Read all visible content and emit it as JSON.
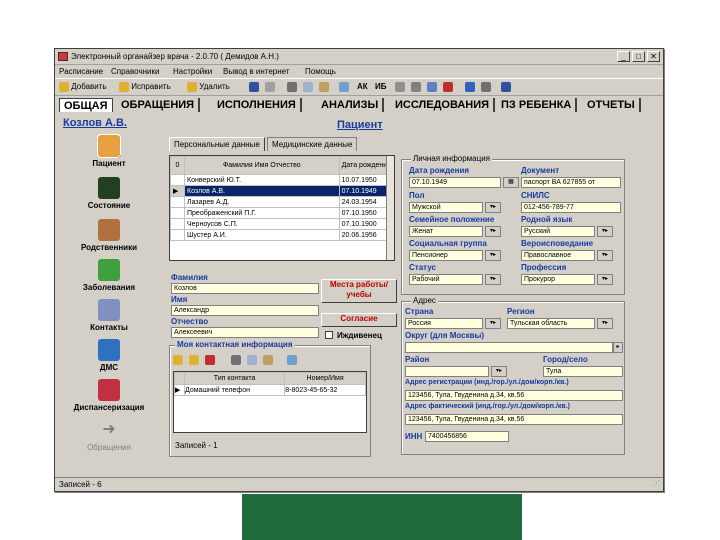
{
  "window": {
    "title": "Электронный органайзер врача - 2.0.70 ( Демидов А.Н.)",
    "min_label": "_",
    "max_label": "□",
    "close_label": "✕"
  },
  "menu": [
    "Расписание",
    "Справочники",
    "Настройки",
    "Вывод в интернет",
    "Помощь"
  ],
  "toolbar": {
    "add_label": "Добавить",
    "edit_label": "Исправить",
    "delete_label": "Удалить",
    "ak_label": "АК",
    "ib_label": "ИБ"
  },
  "main_tabs": [
    "ОБЩАЯ",
    "ОБРАЩЕНИЯ",
    "ИСПОЛНЕНИЯ",
    "АНАЛИЗЫ",
    "ИССЛЕДОВАНИЯ",
    "ПЗ РЕБЕНКА",
    "ОТЧЕТЫ"
  ],
  "patient_name": "Козлов А.В.",
  "patient_link": "Пациент",
  "nav": [
    {
      "label": "Пациент"
    },
    {
      "label": "Состояние"
    },
    {
      "label": "Родственники"
    },
    {
      "label": "Заболевания"
    },
    {
      "label": "Контакты"
    },
    {
      "label": "ДМС"
    },
    {
      "label": "Диспансеризация"
    },
    {
      "label": "Обращения"
    }
  ],
  "subtabs": [
    "Персональные данные",
    "Медицинские данные"
  ],
  "grid": {
    "col_num": "0",
    "col_name": "Фамилия Имя Отчество",
    "col_date": "Дата рождения",
    "rows": [
      {
        "name": "Конверский Ю.Т.",
        "date": "10.07.1950"
      },
      {
        "name": "Козлов А.В.",
        "date": "07.10.1949"
      },
      {
        "name": "Лазарев А.Д.",
        "date": "24.03.1954"
      },
      {
        "name": "Преображенский П.Г.",
        "date": "07.10.1950"
      },
      {
        "name": "Черноусов С.П.",
        "date": "07.10.1900"
      },
      {
        "name": "Шустер А.И.",
        "date": "20.06.1956"
      }
    ]
  },
  "person": {
    "surname_label": "Фамилия",
    "surname": "Козлов",
    "name_label": "Имя",
    "name": "Александр",
    "patronymic_label": "Отчество",
    "patronymic": "Алексеевич"
  },
  "buttons": {
    "workplace": "Места работы/учебы",
    "consent": "Согласие",
    "dependent": "Иждивенец"
  },
  "contact": {
    "title": "Моя контактная информация",
    "col_type": "Тип контакта",
    "col_value": "Номер/Имя",
    "rows": [
      {
        "type": "Домашний телефон",
        "value": "8-8023-45-65-32"
      }
    ],
    "records": "Записей - 1"
  },
  "personal_info": {
    "title": "Личная информация",
    "birth_date_label": "Дата рождения",
    "birth_date": "07.10.1949",
    "document_label": "Документ",
    "document": "паспорт ВА 627855 от",
    "sex_label": "Пол",
    "sex": "Мужской",
    "snils_label": "СНИЛС",
    "snils": "012-456-789-77",
    "family_label": "Семейное положение",
    "family": "Женат",
    "lang_label": "Родной язык",
    "lang": "Русский",
    "social_label": "Социальная группа",
    "social": "Пенсионер",
    "religion_label": "Вероисповедание",
    "religion": "Православное",
    "status_label": "Статус",
    "status": "Рабочий",
    "profession_label": "Профессия",
    "profession": "Прокурор"
  },
  "address": {
    "title": "Адрес",
    "country_label": "Страна",
    "country": "Россия",
    "region_label": "Регион",
    "region": "Тульская область",
    "district_label": "Округ (для Москвы)",
    "area_label": "Район",
    "city_label": "Город/село",
    "city": "Тула",
    "reg_label": "Адрес регистрации (инд./гор./ул./дом/корп./кв.)",
    "reg": "123456, Тула, Гвуденина д.34, кв.56",
    "fact_label": "Адрес фактический (инд./гор./ул./дом/корп./кв.)",
    "fact": "123456, Тула, Гвуденина д.34, кв.56",
    "inn_label": "ИНН",
    "inn": "7400456856"
  },
  "status_bar": "Записей - 6"
}
